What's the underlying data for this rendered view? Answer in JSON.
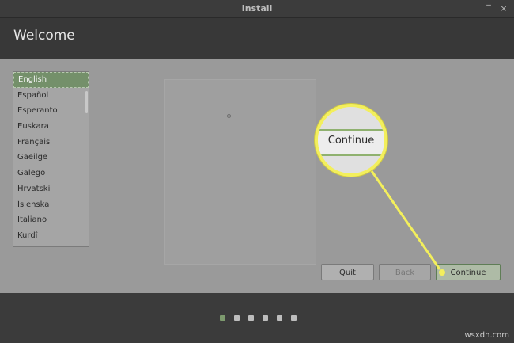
{
  "window": {
    "title": "Install",
    "close_glyph": "×"
  },
  "header": {
    "title": "Welcome"
  },
  "languages": {
    "items": [
      "English",
      "Español",
      "Esperanto",
      "Euskara",
      "Français",
      "Gaeilge",
      "Galego",
      "Hrvatski",
      "Íslenska",
      "Italiano",
      "Kurdî"
    ],
    "selected": "English"
  },
  "buttons": {
    "quit": "Quit",
    "back": "Back",
    "continue": "Continue"
  },
  "callout": {
    "label": "Continue",
    "color": "#f3ef5c"
  },
  "steps": {
    "count": 6,
    "active": 1
  },
  "watermark": "wsxdn.com"
}
